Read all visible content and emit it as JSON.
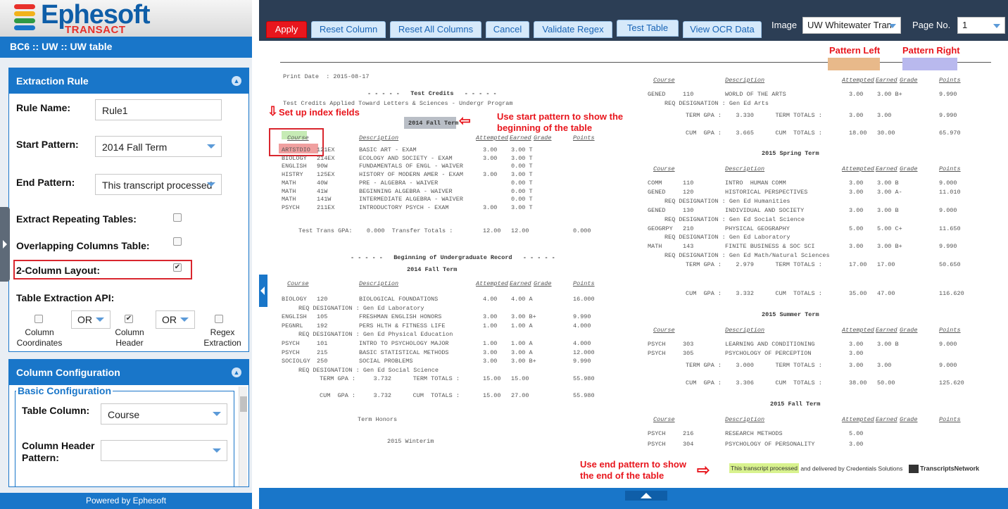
{
  "logo": {
    "brand": "Ephesoft",
    "product": "TRANSACT"
  },
  "breadcrumb": "BC6 :: UW :: UW table",
  "extraction_rule": {
    "title": "Extraction Rule",
    "rule_name_label": "Rule Name:",
    "rule_name_value": "Rule1",
    "start_pattern_label": "Start Pattern:",
    "start_pattern_value": "2014 Fall Term",
    "end_pattern_label": "End Pattern:",
    "end_pattern_value": "This transcript processed",
    "extract_repeating_label": "Extract Repeating Tables:",
    "overlapping_label": "Overlapping Columns Table:",
    "two_column_label": "2-Column Layout:",
    "table_api_label": "Table Extraction API:",
    "op1": "OR",
    "op2": "OR",
    "api_col_coords": "Column\nCoordinates",
    "api_col_header": "Column\nHeader",
    "api_regex": "Regex\nExtraction"
  },
  "column_config": {
    "title": "Column Configuration",
    "basic_title": "Basic Configuration",
    "table_column_label": "Table Column:",
    "table_column_value": "Course",
    "header_pattern_label": "Column Header\nPattern:",
    "header_pattern_value": ""
  },
  "powered_by": "Powered by Ephesoft",
  "toolbar": {
    "apply": "Apply",
    "reset_column": "Reset Column",
    "reset_all": "Reset All Columns",
    "cancel": "Cancel",
    "validate_regex": "Validate Regex",
    "test_table": "Test Table",
    "view_ocr": "View OCR Data",
    "image_label": "Image",
    "image_value": "UW Whitewater Tran",
    "page_label": "Page No.",
    "page_value": "1"
  },
  "annotations": {
    "pattern_left": "Pattern Left",
    "pattern_right": "Pattern Right",
    "set_index": "Set up index fields",
    "start_note": "Use start pattern to show the\nbeginning of the table",
    "end_note": "Use end pattern to show\nthe end of the table",
    "end_highlight": "This transcript processed",
    "end_rest": " and delivered by Credentials Solutions",
    "network": "TranscriptsNetwork"
  },
  "document": {
    "print_date": "Print Date  : 2015-08-17",
    "test_credits": "- - - - -   Test Credits   - - - - -",
    "test_credits_sub": "Test Credits Applied Toward Letters & Sciences - Undergr Program",
    "fall_2014": "2014 Fall Term",
    "header": {
      "course": "Course",
      "description": "Description",
      "attempted": "Attempted",
      "earned": "Earned",
      "grade": "Grade",
      "points": "Points"
    },
    "left_rows_1": [
      [
        "ARTSTDIO",
        "121EX",
        "BASIC ART - EXAM",
        "3.00",
        "3.00 T",
        ""
      ],
      [
        "BIOLOGY",
        "214EX",
        "ECOLOGY AND SOCIETY - EXAM",
        "3.00",
        "3.00 T",
        ""
      ],
      [
        "ENGLISH",
        "90W",
        "FUNDAMENTALS OF ENGL - WAIVER",
        "",
        "0.00 T",
        ""
      ],
      [
        "HISTRY",
        "125EX",
        "HISTORY OF MODERN AMER - EXAM",
        "3.00",
        "3.00 T",
        ""
      ],
      [
        "MATH",
        "40W",
        "PRE - ALGEBRA - WAIVER",
        "",
        "0.00 T",
        ""
      ],
      [
        "MATH",
        "41W",
        "BEGINNING ALGEBRA - WAIVER",
        "",
        "0.00 T",
        ""
      ],
      [
        "MATH",
        "141W",
        "INTERMEDIATE ALGEBRA - WAIVER",
        "",
        "0.00 T",
        ""
      ],
      [
        "PSYCH",
        "211EX",
        "INTRODUCTORY PSYCH - EXAM",
        "3.00",
        "3.00 T",
        ""
      ]
    ],
    "test_trans": "Test Trans GPA:    0.000  Transfer Totals :",
    "test_trans_vals": [
      "12.00",
      "12.00",
      "0.000"
    ],
    "undergrad": "- - - - -   Beginning of Undergraduate Record   - - - - -",
    "left_rows_2": [
      [
        "BIOLOGY",
        "120",
        "BIOLOGICAL FOUNDATIONS",
        "4.00",
        "4.00 A",
        "16.000"
      ],
      [
        "",
        "",
        "REQ DESIGNATION : Gen Ed Laboratory",
        "",
        "",
        ""
      ],
      [
        "ENGLISH",
        "105",
        "FRESHMAN ENGLISH HONORS",
        "3.00",
        "3.00 B+",
        "9.990"
      ],
      [
        "PEGNRL",
        "192",
        "PERS HLTH & FITNESS LIFE",
        "1.00",
        "1.00 A",
        "4.000"
      ],
      [
        "",
        "",
        "REQ DESIGNATION : Gen Ed Physical Education",
        "",
        "",
        ""
      ],
      [
        "PSYCH",
        "101",
        "INTRO TO PSYCHOLOGY MAJOR",
        "1.00",
        "1.00 A",
        "4.000"
      ],
      [
        "PSYCH",
        "215",
        "BASIC STATISTICAL METHODS",
        "3.00",
        "3.00 A",
        "12.000"
      ],
      [
        "SOCIOLGY",
        "250",
        "SOCIAL PROBLEMS",
        "3.00",
        "3.00 B+",
        "9.990"
      ],
      [
        "",
        "",
        "REQ DESIGNATION : Gen Ed Social Science",
        "",
        "",
        ""
      ]
    ],
    "left_term_gpa": "TERM GPA :     3.732      TERM TOTALS :",
    "left_term_vals": [
      "15.00",
      "15.00",
      "55.980"
    ],
    "left_cum_gpa": "CUM  GPA :     3.732      CUM  TOTALS :",
    "left_cum_vals": [
      "15.00",
      "27.00",
      "55.980"
    ],
    "term_honors": "Term Honors",
    "winterim": "2015 Winterim",
    "right_rows_1": [
      [
        "GENED",
        "110",
        "WORLD OF THE ARTS",
        "3.00",
        "3.00 B+",
        "9.990"
      ],
      [
        "",
        "",
        "REQ DESIGNATION : Gen Ed Arts",
        "",
        "",
        ""
      ]
    ],
    "r1_term": "TERM GPA :    3.330      TERM TOTALS :",
    "r1_term_vals": [
      "3.00",
      "3.00",
      "9.990"
    ],
    "r1_cum": "CUM  GPA :    3.665      CUM  TOTALS :",
    "r1_cum_vals": [
      "18.00",
      "30.00",
      "65.970"
    ],
    "spring_2015": "2015 Spring Term",
    "right_rows_2": [
      [
        "COMM",
        "110",
        "INTRO  HUMAN COMM",
        "3.00",
        "3.00 B",
        "9.000"
      ],
      [
        "GENED",
        "120",
        "HISTORICAL PERSPECTIVES",
        "3.00",
        "3.00 A-",
        "11.010"
      ],
      [
        "",
        "",
        "REQ DESIGNATION : Gen Ed Humanities",
        "",
        "",
        ""
      ],
      [
        "GENED",
        "130",
        "INDIVIDUAL AND SOCIETY",
        "3.00",
        "3.00 B",
        "9.000"
      ],
      [
        "",
        "",
        "REQ DESIGNATION : Gen Ed Social Science",
        "",
        "",
        ""
      ],
      [
        "GEOGRPY",
        "210",
        "PHYSICAL GEOGRAPHY",
        "5.00",
        "5.00 C+",
        "11.650"
      ],
      [
        "",
        "",
        "REQ DESIGNATION : Gen Ed Laboratory",
        "",
        "",
        ""
      ],
      [
        "MATH",
        "143",
        "FINITE BUSINESS & SOC SCI",
        "3.00",
        "3.00 B+",
        "9.990"
      ],
      [
        "",
        "",
        "REQ DESIGNATION : Gen Ed Math/Natural Sciences",
        "",
        "",
        ""
      ]
    ],
    "r2_term": "TERM GPA :    2.979      TERM TOTALS :",
    "r2_term_vals": [
      "17.00",
      "17.00",
      "50.650"
    ],
    "r2_cum": "CUM  GPA :    3.332      CUM  TOTALS :",
    "r2_cum_vals": [
      "35.00",
      "47.00",
      "116.620"
    ],
    "summer_2015": "2015 Summer Term",
    "right_rows_3": [
      [
        "PSYCH",
        "303",
        "LEARNING AND CONDITIONING",
        "3.00",
        "3.00 B",
        "9.000"
      ],
      [
        "PSYCH",
        "305",
        "PSYCHOLOGY OF PERCEPTION",
        "3.00",
        "",
        ""
      ]
    ],
    "r3_term": "TERM GPA :    3.000      TERM TOTALS :",
    "r3_term_vals": [
      "3.00",
      "3.00",
      "9.000"
    ],
    "r3_cum": "CUM  GPA :    3.306      CUM  TOTALS :",
    "r3_cum_vals": [
      "38.00",
      "50.00",
      "125.620"
    ],
    "fall_2015": "2015 Fall Term",
    "right_rows_4": [
      [
        "PSYCH",
        "216",
        "RESEARCH METHODS",
        "5.00",
        "",
        ""
      ],
      [
        "PSYCH",
        "304",
        "PSYCHOLOGY OF PERSONALITY",
        "3.00",
        "",
        ""
      ]
    ]
  },
  "colors": {
    "accent": "#1976c9",
    "apply": "#e8161d",
    "topbar": "#2c3e55",
    "annotation": "#e8161d"
  }
}
